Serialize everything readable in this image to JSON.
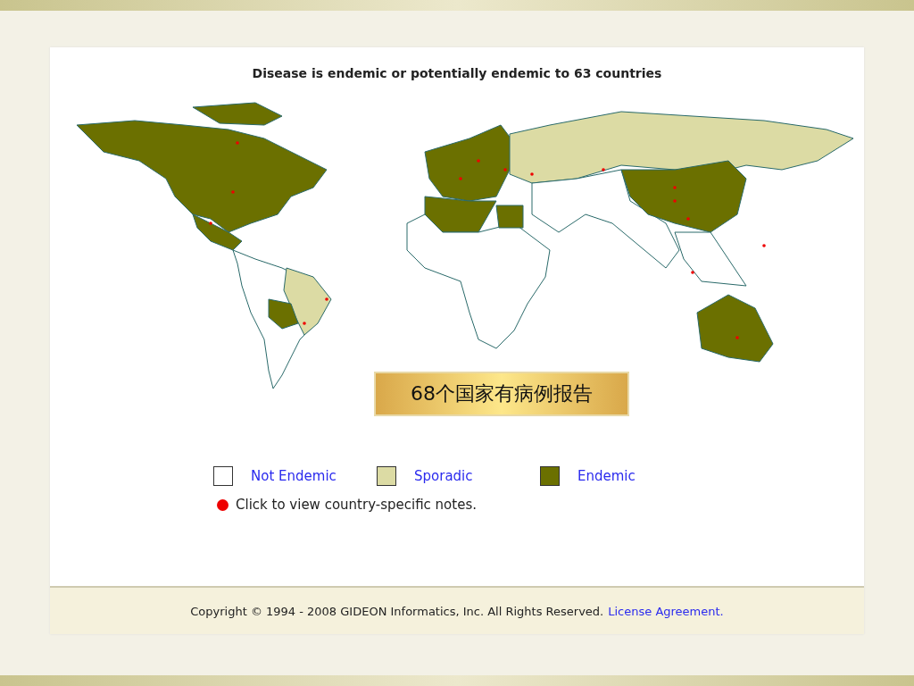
{
  "title": "Disease is endemic or potentially endemic to 63 countries",
  "callout": "68个国家有病例报告",
  "legend": [
    {
      "label": "Not Endemic",
      "color": "#ffffff"
    },
    {
      "label": "Sporadic",
      "color": "#dcdba4"
    },
    {
      "label": "Endemic",
      "color": "#6b7000"
    }
  ],
  "note": "Click to view country-specific notes.",
  "footer": {
    "text": "Copyright © 1994 - 2008 GIDEON Informatics, Inc. All Rights Reserved.",
    "link": "License Agreement."
  }
}
